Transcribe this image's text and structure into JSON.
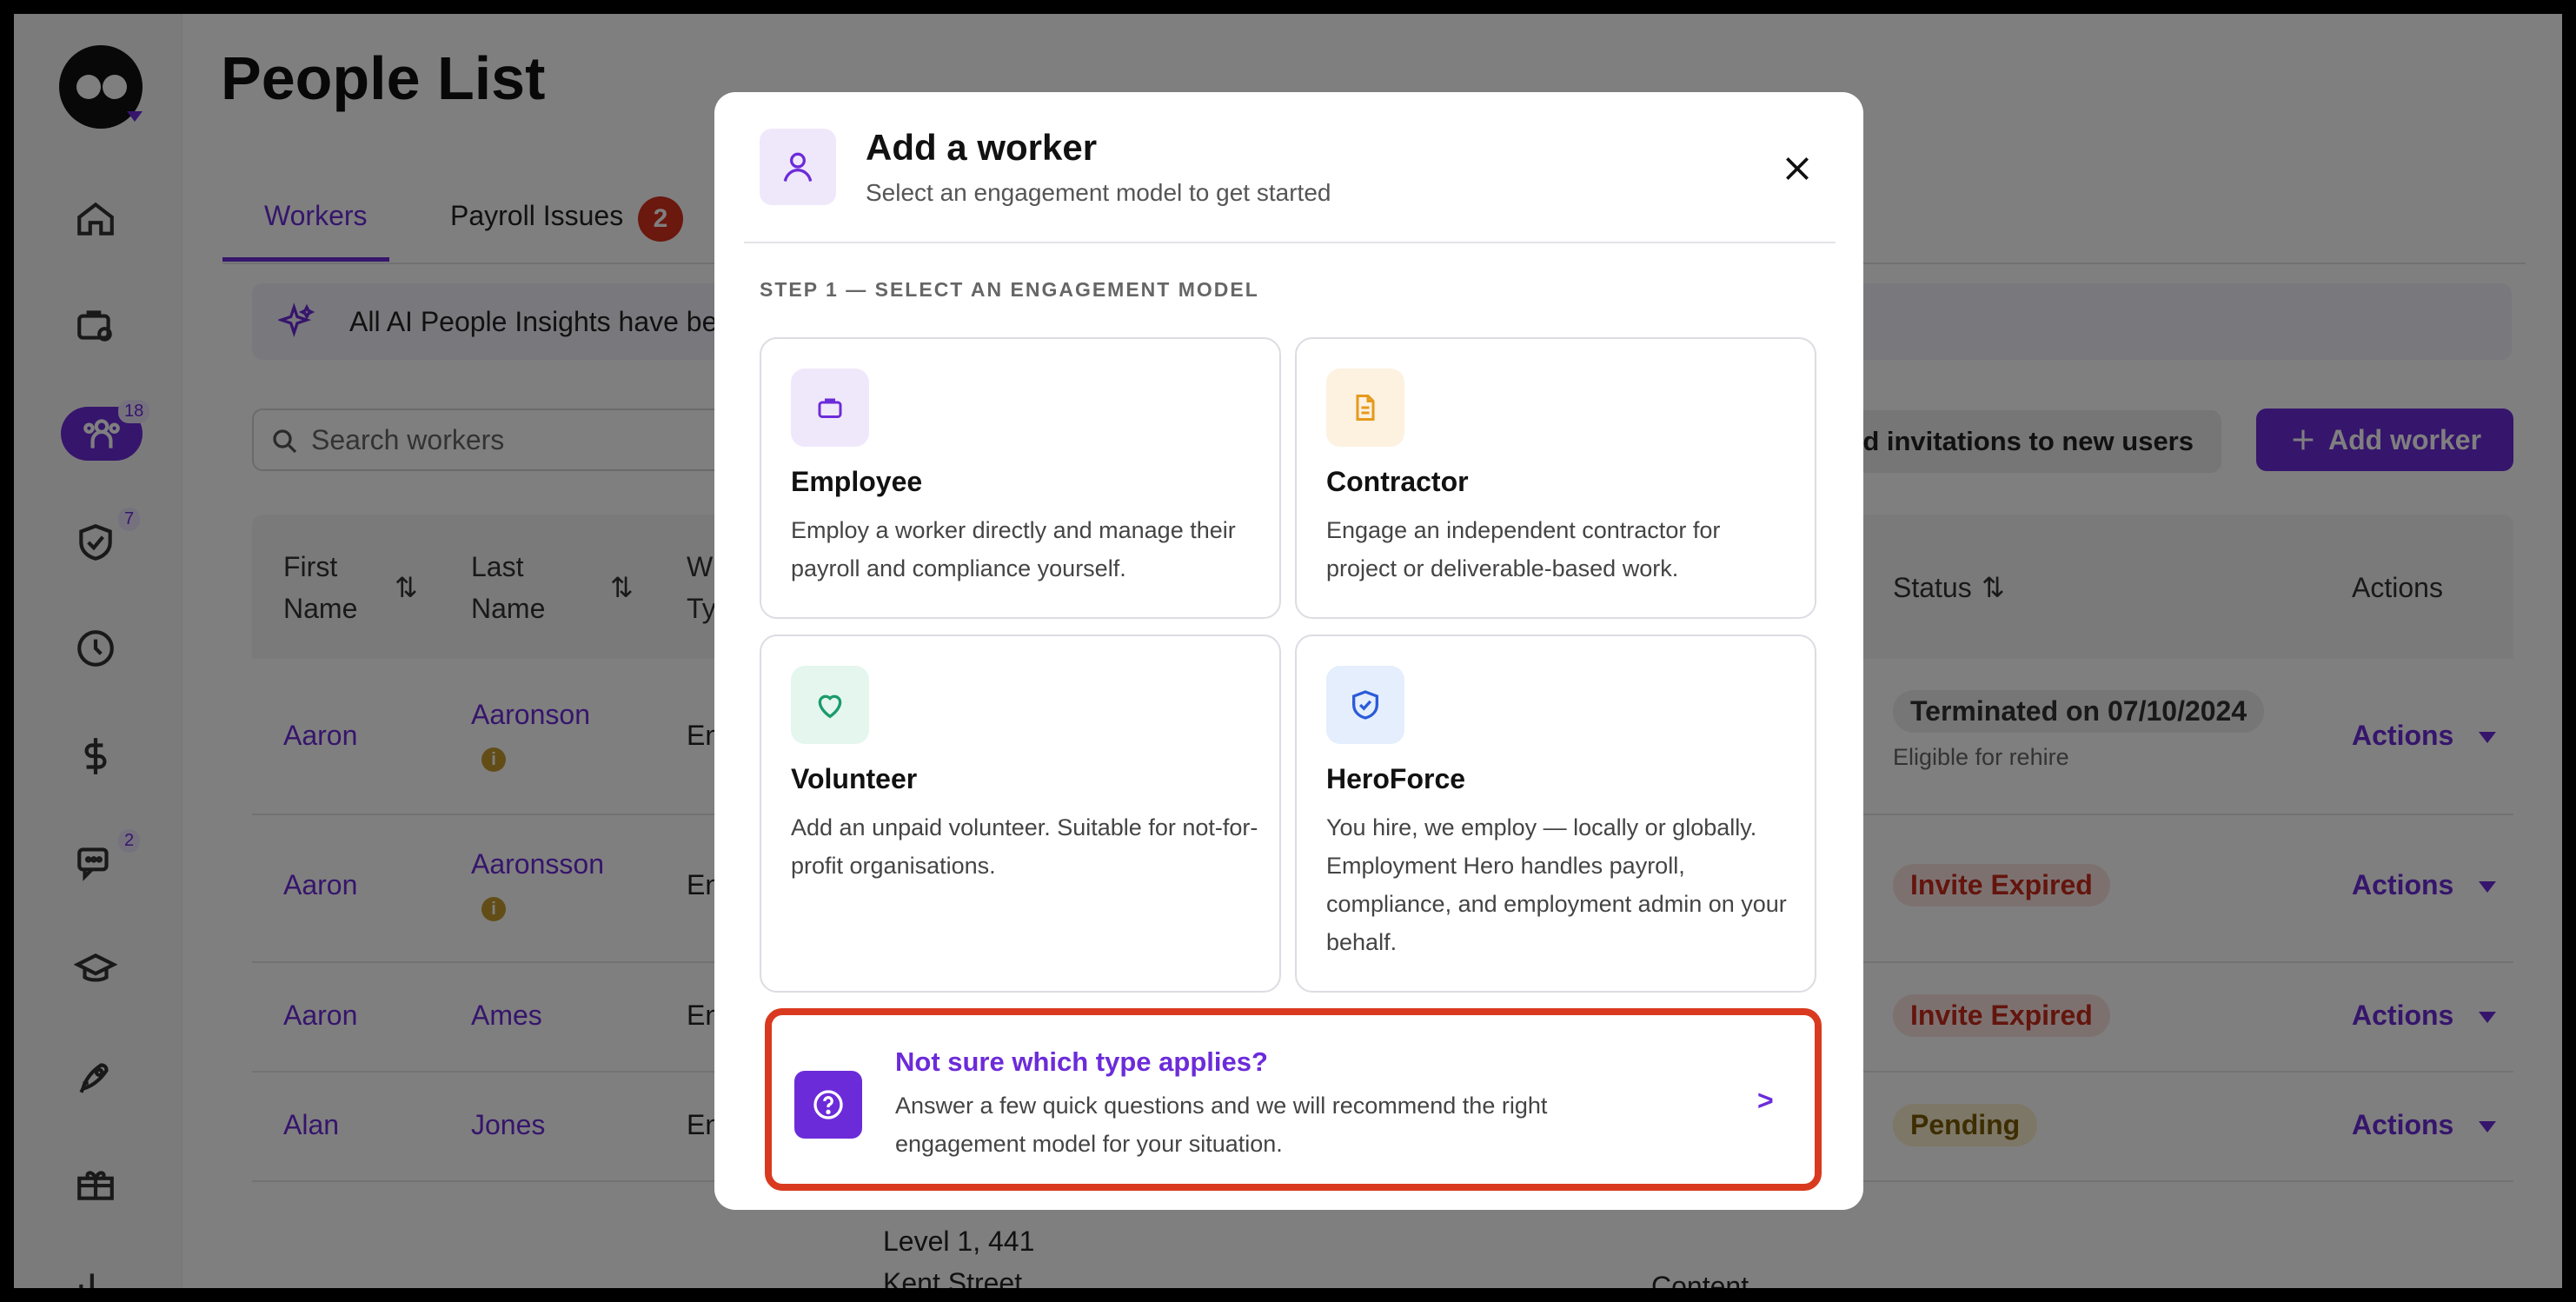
{
  "page": {
    "title": "People List"
  },
  "tabs": [
    {
      "label": "Workers",
      "active": true
    },
    {
      "label": "Payroll Issues",
      "badge": "2"
    }
  ],
  "ai_banner": {
    "text": "All AI People Insights have be"
  },
  "search": {
    "placeholder": "Search workers"
  },
  "toolbar": {
    "resend_label": "d invitations to new users",
    "add_worker_label": "Add worker"
  },
  "sidebar": {
    "badges": {
      "people": "18",
      "compliance": "7",
      "messages": "2"
    }
  },
  "table": {
    "headers": {
      "first_name": "First Name",
      "last_name": "Last Name",
      "work_type": "W Ty",
      "status": "Status",
      "actions": "Actions"
    },
    "rows": [
      {
        "first": "Aaron",
        "last": "Aaronson",
        "type": "En",
        "status": "Terminated on 07/10/2024",
        "status_note": "Eligible for rehire",
        "actions": "Actions"
      },
      {
        "first": "Aaron",
        "last": "Aaronsson",
        "type": "En",
        "status": "Invite Expired",
        "actions": "Actions"
      },
      {
        "first": "Aaron",
        "last": "Ames",
        "type": "En",
        "status": "Invite Expired",
        "actions": "Actions"
      },
      {
        "first": "Alan",
        "last": "Jones",
        "type": "En",
        "status": "Pending",
        "actions": "Actions"
      }
    ],
    "partial_row": {
      "address_line1": "Level 1, 441",
      "address_line2": "Kent Street,",
      "department": "Content"
    }
  },
  "modal": {
    "title": "Add a worker",
    "subtitle": "Select an engagement model to get started",
    "step_label": "STEP 1 — SELECT AN ENGAGEMENT MODEL",
    "cards": [
      {
        "title": "Employee",
        "description": "Employ a worker directly and manage their payroll and compliance yourself.",
        "icon": "briefcase-icon"
      },
      {
        "title": "Contractor",
        "description": "Engage an independent contractor for project or deliverable-based work.",
        "icon": "document-icon"
      },
      {
        "title": "Volunteer",
        "description": "Add an unpaid volunteer. Suitable for not-for-profit organisations.",
        "icon": "heart-icon"
      },
      {
        "title": "HeroForce",
        "description": "You hire, we employ — locally or globally. Employment Hero handles payroll, compliance, and employment admin on your behalf.",
        "icon": "shield-check-icon"
      }
    ],
    "help": {
      "title": "Not sure which type applies?",
      "description": "Answer a few quick questions and we will recommend the right engagement model for your situation.",
      "chevron": ">"
    }
  },
  "colors": {
    "brand_purple": "#6c2bd9",
    "highlight_red": "#d93a1f"
  }
}
